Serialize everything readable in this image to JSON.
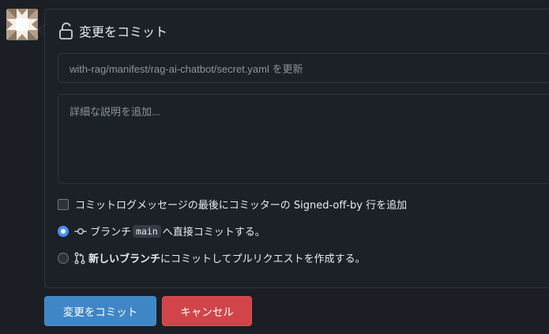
{
  "commit_form": {
    "title": "変更をコミット",
    "summary_placeholder": "with-rag/manifest/rag-ai-chatbot/secret.yaml を更新",
    "description_placeholder": "詳細な説明を追加...",
    "signoff_label": "コミットログメッセージの最後にコミッターの Signed-off-by 行を追加",
    "direct_commit": {
      "prefix": "ブランチ",
      "branch": "main",
      "suffix": "へ直接コミットする。"
    },
    "new_branch": {
      "bold": "新しいブランチ",
      "rest": "にコミットしてプルリクエストを作成する。"
    }
  },
  "buttons": {
    "commit": "変更をコミット",
    "cancel": "キャンセル"
  },
  "colors": {
    "background": "#1b1f25",
    "commit_button": "#3f86c6",
    "cancel_button": "#d1454a",
    "radio_selected": "#4493f8"
  },
  "icons": [
    "avatar-identicon",
    "unlock-icon",
    "git-commit-icon",
    "git-pull-request-icon"
  ]
}
